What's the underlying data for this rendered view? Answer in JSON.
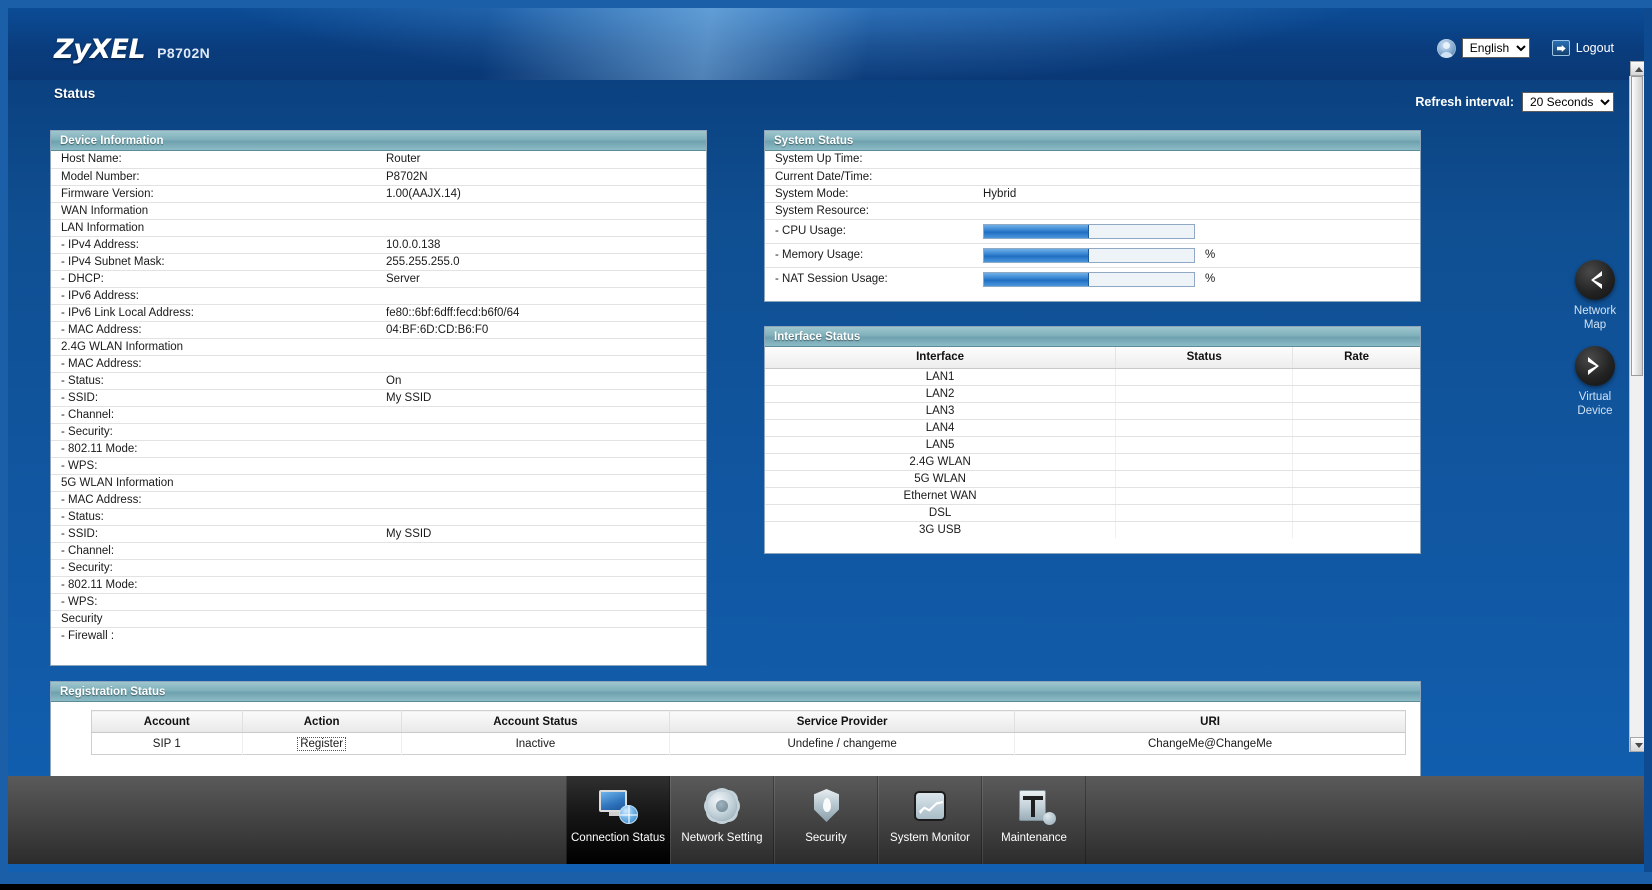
{
  "header": {
    "brand": "ZyXEL",
    "model": "P8702N",
    "page_title": "Status",
    "language": "English",
    "language_options": [
      "English"
    ],
    "logout_label": "Logout",
    "refresh_label": "Refresh interval:",
    "refresh_value": "20 Seconds",
    "refresh_options": [
      "20 Seconds"
    ]
  },
  "device_information": {
    "title": "Device Information",
    "rows": [
      {
        "label": "Host Name:",
        "value": "Router",
        "indent": false
      },
      {
        "label": "Model Number:",
        "value": "P8702N",
        "indent": false
      },
      {
        "label": "Firmware Version:",
        "value": "1.00(AAJX.14)",
        "indent": false
      },
      {
        "label": "WAN Information",
        "value": "",
        "indent": false
      },
      {
        "label": "LAN Information",
        "value": "",
        "indent": false
      },
      {
        "label": "- IPv4 Address:",
        "value": "10.0.0.138",
        "indent": true
      },
      {
        "label": "- IPv4 Subnet Mask:",
        "value": "255.255.255.0",
        "indent": true
      },
      {
        "label": "- DHCP:",
        "value": "Server",
        "indent": true
      },
      {
        "label": "- IPv6 Address:",
        "value": "",
        "indent": true
      },
      {
        "label": "- IPv6 Link Local Address:",
        "value": "fe80::6bf:6dff:fecd:b6f0/64",
        "indent": true
      },
      {
        "label": "- MAC Address:",
        "value": "04:BF:6D:CD:B6:F0",
        "indent": true
      },
      {
        "label": "2.4G WLAN Information",
        "value": "",
        "indent": false
      },
      {
        "label": "- MAC Address:",
        "value": "",
        "indent": true
      },
      {
        "label": "- Status:",
        "value": "On",
        "indent": true
      },
      {
        "label": "- SSID:",
        "value": "My SSID",
        "indent": true
      },
      {
        "label": "- Channel:",
        "value": "",
        "indent": true
      },
      {
        "label": "- Security:",
        "value": "",
        "indent": true
      },
      {
        "label": "- 802.11 Mode:",
        "value": "",
        "indent": true
      },
      {
        "label": "- WPS:",
        "value": "",
        "indent": true
      },
      {
        "label": "5G WLAN Information",
        "value": "",
        "indent": false
      },
      {
        "label": "- MAC Address:",
        "value": "",
        "indent": true
      },
      {
        "label": "- Status:",
        "value": "",
        "indent": true
      },
      {
        "label": "- SSID:",
        "value": "My SSID",
        "indent": true
      },
      {
        "label": "- Channel:",
        "value": "",
        "indent": true
      },
      {
        "label": "- Security:",
        "value": "",
        "indent": true
      },
      {
        "label": "- 802.11 Mode:",
        "value": "",
        "indent": true
      },
      {
        "label": "- WPS:",
        "value": "",
        "indent": true
      },
      {
        "label": "Security",
        "value": "",
        "indent": false
      },
      {
        "label": "- Firewall :",
        "value": "",
        "indent": true
      }
    ]
  },
  "system_status": {
    "title": "System Status",
    "rows": [
      {
        "label": "System Up Time:",
        "value": ""
      },
      {
        "label": "Current Date/Time:",
        "value": ""
      },
      {
        "label": "System Mode:",
        "value": "Hybrid"
      },
      {
        "label": "System Resource:",
        "value": ""
      }
    ],
    "gauges": [
      {
        "label": "- CPU Usage:",
        "percent": 50,
        "unit": ""
      },
      {
        "label": "- Memory Usage:",
        "percent": 50,
        "unit": "%"
      },
      {
        "label": "- NAT Session Usage:",
        "percent": 50,
        "unit": "%"
      }
    ]
  },
  "interface_status": {
    "title": "Interface Status",
    "columns": [
      "Interface",
      "Status",
      "Rate"
    ],
    "rows": [
      [
        "LAN1",
        "",
        ""
      ],
      [
        "LAN2",
        "",
        ""
      ],
      [
        "LAN3",
        "",
        ""
      ],
      [
        "LAN4",
        "",
        ""
      ],
      [
        "LAN5",
        "",
        ""
      ],
      [
        "2.4G WLAN",
        "",
        ""
      ],
      [
        "5G WLAN",
        "",
        ""
      ],
      [
        "Ethernet WAN",
        "",
        ""
      ],
      [
        "DSL",
        "",
        ""
      ],
      [
        "3G USB",
        "",
        ""
      ]
    ]
  },
  "registration_status": {
    "title": "Registration Status",
    "columns": [
      "Account",
      "Action",
      "Account Status",
      "Service Provider",
      "URI"
    ],
    "rows": [
      {
        "account": "SIP 1",
        "action": "Register",
        "account_status": "Inactive",
        "service_provider": "Undefine / changeme",
        "uri": "ChangeMe@ChangeMe"
      }
    ]
  },
  "side_buttons": [
    {
      "label_line1": "Network",
      "label_line2": "Map",
      "icon": "chevron-left-icon"
    },
    {
      "label_line1": "Virtual",
      "label_line2": "Device",
      "icon": "chevron-right-icon"
    }
  ],
  "bottom_nav": [
    {
      "label": "Connection Status",
      "icon": "monitor-globe-icon",
      "active": true
    },
    {
      "label": "Network Setting",
      "icon": "gear-icon",
      "active": false
    },
    {
      "label": "Security",
      "icon": "shield-flame-icon",
      "active": false
    },
    {
      "label": "System Monitor",
      "icon": "line-chart-icon",
      "active": false
    },
    {
      "label": "Maintenance",
      "icon": "toolbox-icon",
      "active": false
    }
  ],
  "colors": {
    "brand_blue": "#0d4a8f",
    "panel_header": "#7fb0bb",
    "progress_fill": "#2f7fcf",
    "nav_bar": "#3a3a3a"
  }
}
